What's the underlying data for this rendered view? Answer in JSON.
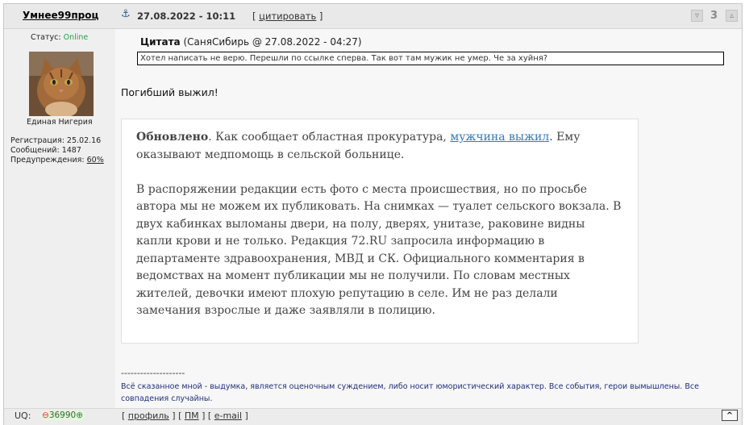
{
  "user": {
    "name": "Умнее99проц",
    "status_label": "Статус:",
    "status_value": "Online",
    "title": "Единая Нигерия",
    "registration": "Регистрация: 25.02.16",
    "messages": "Сообщений: 1487",
    "warnings_label": "Предупреждения:",
    "warnings_value": "60%"
  },
  "post": {
    "date": "27.08.2022 - 10:11",
    "quote_action": "цитировать",
    "vote_count": "3",
    "quote_author_label": "Цитата",
    "quote_author_meta": "(СаняСибирь @ 27.08.2022 - 04:27)",
    "quote_text": "Хотел написать не верю. Перешли по ссылке сперва. Так вот там мужик не умер. Че за хуйня?",
    "body_line": "Погибший выжил!",
    "article": {
      "p1_bold": "Обновлено",
      "p1_pre": ". Как сообщает областная прокуратура, ",
      "p1_link": "мужчина выжил",
      "p1_post": ". Ему оказывают медпомощь в сельской больнице.",
      "p2": "В распоряжении редакции есть фото с места происшествия, но по просьбе автора мы не можем их публиковать. На снимках — туалет сельского вокзала. В двух кабинках выломаны двери, на полу, дверях, унитазе, раковине видны капли крови и не только. Редакция 72.RU запросила информацию в департаменте здравоохранения, МВД и СК. Официального комментария в ведомствах на момент публикации мы не получили. По словам местных жителей, девочки имеют плохую репутацию в селе. Им не раз делали замечания взрослые и даже заявляли в полицию."
    },
    "signature_divider": "--------------------",
    "signature": "Всё сказанное мной - выдумка, является оценочным суждением, либо носит юмористический характер. Все события, герои вымышлены. Все совпадения случайны."
  },
  "footer": {
    "uq_label": "UQ:",
    "uq_value": "36990",
    "profile": "профиль",
    "pm": "ПМ",
    "email": "e-mail",
    "top": "^"
  },
  "icons": {
    "anchor": "anchor-icon",
    "vote_down": "thumb-down-icon",
    "vote_up": "thumb-up-icon"
  },
  "colors": {
    "online": "#2ea043",
    "link": "#2d7cc1",
    "signature": "#1f2f7a"
  }
}
